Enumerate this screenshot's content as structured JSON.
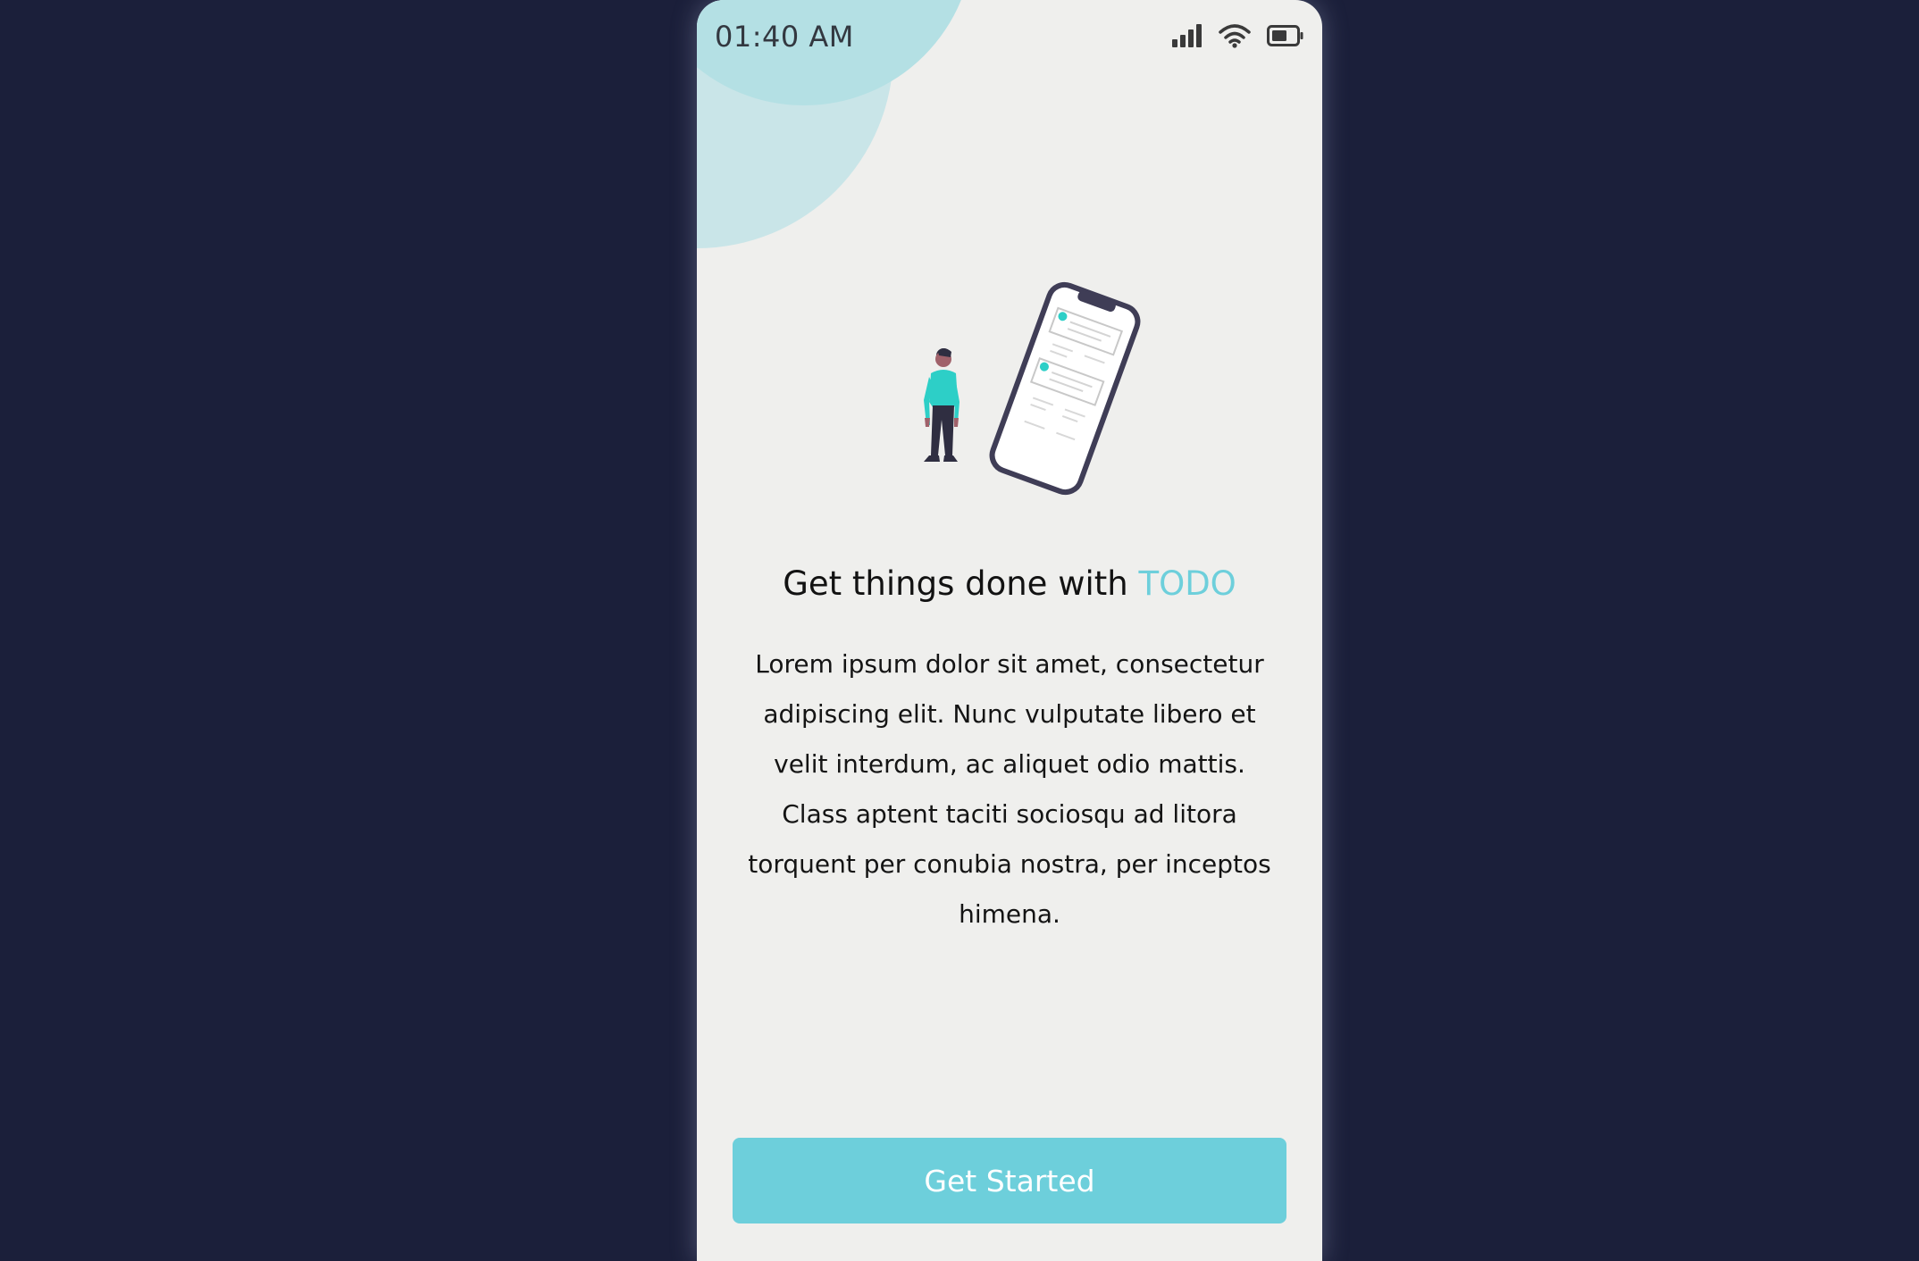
{
  "status_bar": {
    "time": "01:40 AM",
    "icons": [
      "signal-icon",
      "wifi-icon",
      "battery-icon"
    ]
  },
  "illustration": {
    "name": "person-with-phone-illustration"
  },
  "headline": {
    "prefix": "Get things done with ",
    "brand": "TODO"
  },
  "description": "Lorem ipsum dolor sit amet, consectetur adipiscing elit. Nunc vulputate libero et velit interdum, ac aliquet odio mattis. Class aptent taciti sociosqu ad litora torquent per conubia nostra, per inceptos himena.",
  "cta": {
    "label": "Get Started"
  },
  "colors": {
    "background": "#1b1f3a",
    "screen": "#efefed",
    "accent": "#6dcfdb",
    "blob_light": "#c9e5e8",
    "blob_dark": "#b4e0e4",
    "illustration_teal": "#2dcfc7",
    "illustration_dark": "#3f3d56"
  }
}
